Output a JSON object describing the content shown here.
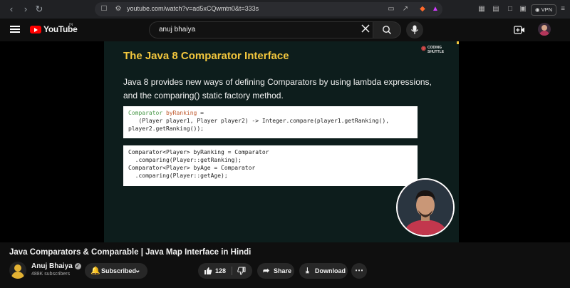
{
  "browser": {
    "url": "youtube.com/watch?v=ad5xCQwmtn0&t=333s",
    "vpn_label": "VPN",
    "icons": [
      "back-icon",
      "forward-icon",
      "reload-icon",
      "bookmark-icon",
      "site-settings-icon",
      "cast-icon",
      "share-icon",
      "star-icon",
      "brave-shield-icon",
      "brave-rewards-icon",
      "extensions-icon",
      "sidebar-icon",
      "tab-icon",
      "wallet-icon",
      "menu-icon"
    ]
  },
  "header": {
    "logo_text": "YouTube",
    "region": "IN",
    "search_query": "anuj bhaiya"
  },
  "slide": {
    "title": "The Java 8 Comparator Interface",
    "logo_line1": "CODING",
    "logo_line2": "SHUTTLE",
    "paragraph": "Java 8 provides new ways of defining Comparators by using lambda expressions, and the comparing() static factory method.",
    "code1": {
      "l1a": "Comparator",
      "l1b": " byRanking",
      "l1c": " =",
      "l2": "   (Player player1, Player player2) -> Integer.compare(player1.getRanking(),",
      "l3": "player2.getRanking());"
    },
    "code2": {
      "l1": "Comparator<Player> byRanking = Comparator",
      "l2": "  .comparing(Player::getRanking);",
      "l3": "Comparator<Player> byAge = Comparator",
      "l4": "  .comparing(Player::getAge);"
    }
  },
  "video": {
    "title": "Java Comparators & Comparable | Java Map Interface in Hindi"
  },
  "channel": {
    "name": "Anuj Bhaiya",
    "subscribers": "488K subscribers",
    "subscribed_label": "Subscribed"
  },
  "actions": {
    "likes": "128",
    "share_label": "Share",
    "download_label": "Download"
  }
}
